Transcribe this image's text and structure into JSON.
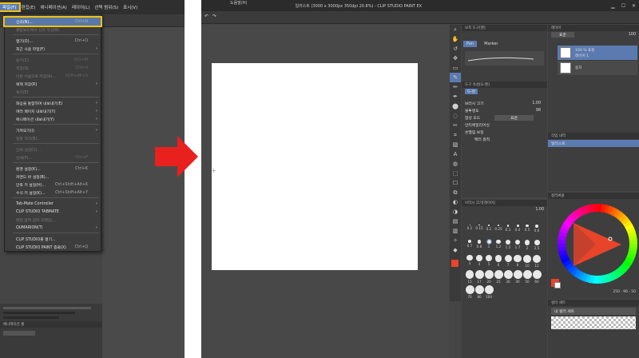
{
  "left_screen": {
    "menubar": [
      "파일(F)",
      "편집(E)",
      "애니메이션(A)",
      "레이어(L)",
      "선택 범위(S)",
      "표시(V)"
    ],
    "file_menu": [
      {
        "label": "신규(N)...",
        "shortcut": "Ctrl+N",
        "highlight": true,
        "disabled": false,
        "submenu": false
      },
      {
        "label": "클립보드에서 신규 작성(B)",
        "shortcut": "",
        "disabled": true,
        "submenu": false
      },
      {
        "label": "열기(O)...",
        "shortcut": "Ctrl+O",
        "disabled": false,
        "submenu": false
      },
      {
        "label": "최근 사용 파일(F)",
        "shortcut": "",
        "disabled": false,
        "submenu": true
      },
      {
        "label": "닫기(C)",
        "shortcut": "Ctrl+W",
        "disabled": true,
        "submenu": false
      },
      {
        "label": "저장(S)",
        "shortcut": "Ctrl+S",
        "disabled": true,
        "submenu": false
      },
      {
        "label": "다른 이름으로 저장(A)...",
        "shortcut": "Shift+Alt+S",
        "disabled": true,
        "submenu": false
      },
      {
        "label": "복제 저장(R)",
        "shortcut": "",
        "disabled": false,
        "submenu": true
      },
      {
        "label": "복귀(E)",
        "shortcut": "",
        "disabled": true,
        "submenu": false
      },
      {
        "label": "화상을 통합하여 내보내기(E)",
        "shortcut": "",
        "disabled": false,
        "submenu": true
      },
      {
        "label": "여러 페이지 내보내기(Y)",
        "shortcut": "",
        "disabled": false,
        "submenu": true
      },
      {
        "label": "애니메이션 내보내기(Y)",
        "shortcut": "",
        "disabled": false,
        "submenu": true
      },
      {
        "label": "가져오기(I)",
        "shortcut": "",
        "disabled": false,
        "submenu": true
      },
      {
        "label": "일괄 처리(B)...",
        "shortcut": "",
        "disabled": true,
        "submenu": false
      },
      {
        "label": "인쇄 설정(U)...",
        "shortcut": "",
        "disabled": true,
        "submenu": false
      },
      {
        "label": "인쇄(P)...",
        "shortcut": "Ctrl+P",
        "disabled": true,
        "submenu": false
      },
      {
        "label": "환경 설정(K)...",
        "shortcut": "Ctrl+K",
        "disabled": false,
        "submenu": false
      },
      {
        "label": "커맨드 바 설정(B)...",
        "shortcut": "",
        "disabled": false,
        "submenu": false
      },
      {
        "label": "단축 키 설정(H)...",
        "shortcut": "Ctrl+Shift+Alt+K",
        "disabled": false,
        "submenu": false
      },
      {
        "label": "수식 키 설정(K)...",
        "shortcut": "Ctrl+Shift+Alt+Y",
        "disabled": false,
        "submenu": false
      },
      {
        "label": "Tab-Mate Controller",
        "shortcut": "",
        "disabled": false,
        "submenu": true
      },
      {
        "label": "CLIP STUDIO TABMATE",
        "shortcut": "",
        "disabled": false,
        "submenu": true
      },
      {
        "label": "펜탭 압력 감지 조절(J)...",
        "shortcut": "",
        "disabled": true,
        "submenu": false
      },
      {
        "label": "QUMARION(T)",
        "shortcut": "",
        "disabled": false,
        "submenu": true
      },
      {
        "label": "CLIP STUDIO를 열기...",
        "shortcut": "",
        "disabled": false,
        "submenu": false
      },
      {
        "label": "CLIP STUDIO PAINT 종료(X)",
        "shortcut": "Ctrl+Q",
        "disabled": false,
        "submenu": false
      }
    ],
    "bottom_panel_label": "애니메이션 셀"
  },
  "right_screen": {
    "title": "일러스트 (3000 x 3000px 350dpi 20.8%) - CLIP STUDIO PAINT EX",
    "menu_item": "도움말(H)",
    "subtool": {
      "header": "보조 도구[펜]",
      "tabs": [
        "Pen",
        "Marker"
      ],
      "detail_header": "도구 속성[G-펜]",
      "tool_name": "G-펜",
      "brush_size_label": "브러시 크기",
      "brush_size_value": "1.00",
      "opacity_label": "불투명도",
      "opacity_value": "98",
      "blend_label": "합성 모드",
      "blend_value": "표준",
      "aa_label": "안티에일리어싱",
      "stabilization_label": "손떨림 보정",
      "vector_label": "벡터 흡착"
    },
    "brush_panel": {
      "header": "브러시 크기[레이어]",
      "top_value": "1.00",
      "sizes": [
        "0.1",
        "0.15",
        "0.2",
        "0.25",
        "0.3",
        "0.4",
        "0.5",
        "0.6",
        "0.7",
        "0.8",
        "1",
        "1.2",
        "1.5",
        "1.7",
        "2",
        "2.5",
        "3",
        "4",
        "5",
        "6",
        "7",
        "8",
        "10",
        "12",
        "15",
        "17",
        "20",
        "25",
        "30",
        "40",
        "50",
        "60",
        "70",
        "80",
        "100"
      ]
    },
    "layers": {
      "header": "레이어",
      "blend": "표준",
      "opacity": "100",
      "rows": [
        {
          "name": "100 % 표준",
          "sub": "레이어 1",
          "selected": true
        },
        {
          "name": "용지",
          "sub": "",
          "selected": false
        }
      ],
      "bottom_header": "작업 내역",
      "history_item": "일러스트"
    },
    "color": {
      "header": "컬러써클",
      "values": [
        "250",
        "96",
        "50"
      ]
    },
    "colorset": {
      "header": "컬러 세트",
      "name": "내 컬러 세트"
    },
    "colors": {
      "accent": "#5b7bb0",
      "highlight": "#f2c114",
      "main_color": "#e8442a",
      "arrow": "#e8201e"
    }
  }
}
